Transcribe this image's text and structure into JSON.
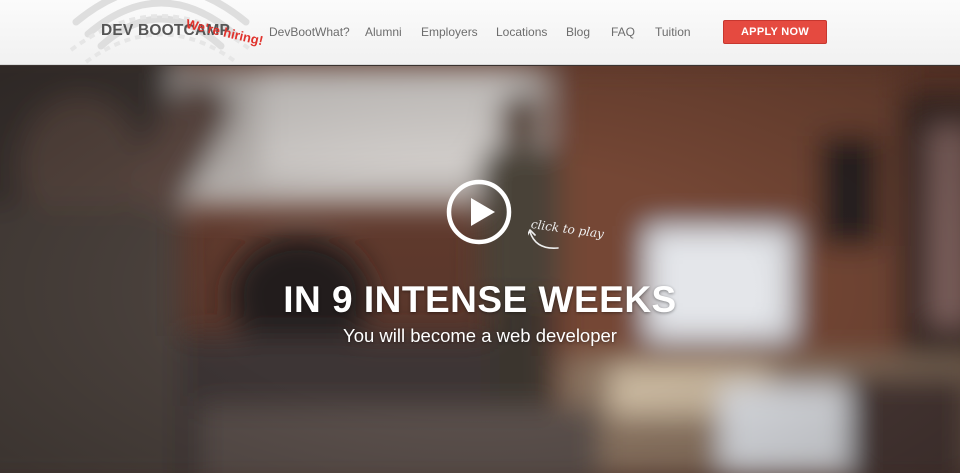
{
  "header": {
    "logo_text": "DEV BOOTCAMP",
    "hiring_badge": "We're hiring!",
    "nav": [
      {
        "label": "DevBootWhat?"
      },
      {
        "label": "Alumni"
      },
      {
        "label": "Employers"
      },
      {
        "label": "Locations"
      },
      {
        "label": "Blog"
      },
      {
        "label": "FAQ"
      },
      {
        "label": "Tuition"
      }
    ],
    "apply_label": "APPLY NOW"
  },
  "hero": {
    "play_hint": "click to play",
    "headline": "IN 9 INTENSE WEEKS",
    "subheadline": "You will become a web developer",
    "play_icon": "play-circle-icon"
  },
  "colors": {
    "accent": "#e54a40",
    "hiring_red": "#e0332d",
    "nav_text": "#6d6d6d",
    "logo_text": "#555555"
  }
}
